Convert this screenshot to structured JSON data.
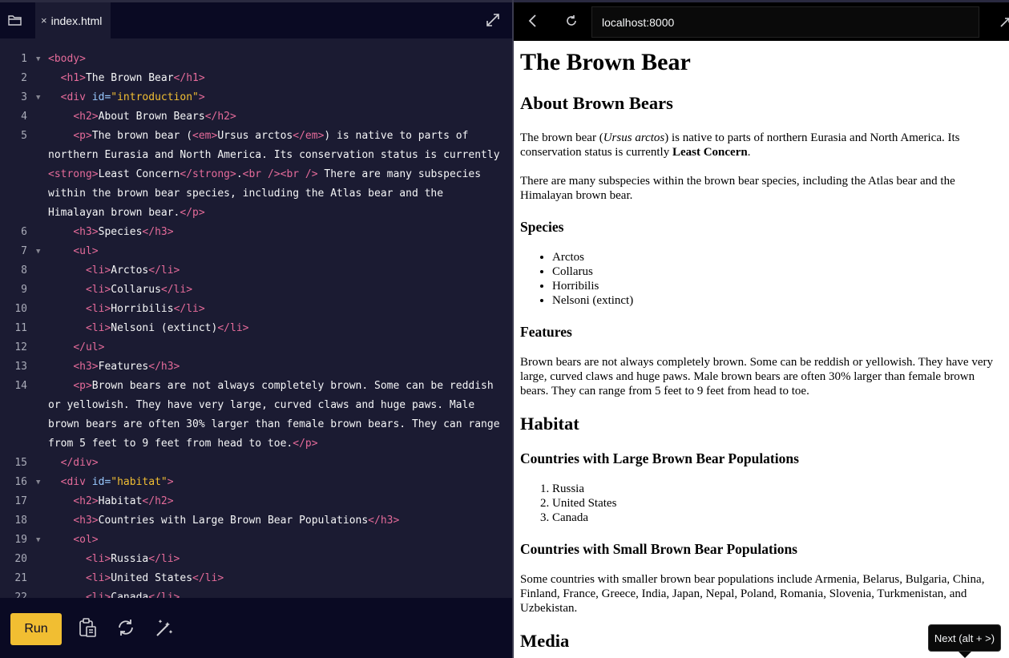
{
  "editor": {
    "file_tab": {
      "close": "×",
      "name": "index.html"
    },
    "lines": [
      {
        "n": "1",
        "fold": "▼",
        "indent": 0,
        "segs": [
          [
            "tag",
            "<body>"
          ]
        ]
      },
      {
        "n": "2",
        "fold": "",
        "indent": 2,
        "segs": [
          [
            "tag",
            "<h1>"
          ],
          [
            "text",
            "The Brown Bear"
          ],
          [
            "tag",
            "</h1>"
          ]
        ]
      },
      {
        "n": "3",
        "fold": "▼",
        "indent": 2,
        "segs": [
          [
            "tag",
            "<div "
          ],
          [
            "attr",
            "id="
          ],
          [
            "str",
            "\"introduction\""
          ],
          [
            "tag",
            ">"
          ]
        ]
      },
      {
        "n": "4",
        "fold": "",
        "indent": 4,
        "segs": [
          [
            "tag",
            "<h2>"
          ],
          [
            "text",
            "About Brown Bears"
          ],
          [
            "tag",
            "</h2>"
          ]
        ]
      },
      {
        "n": "5",
        "fold": "",
        "indent": 4,
        "segs": [
          [
            "tag",
            "<p>"
          ],
          [
            "text",
            "The brown bear ("
          ],
          [
            "tag",
            "<em>"
          ],
          [
            "text",
            "Ursus arctos"
          ],
          [
            "tag",
            "</em>"
          ],
          [
            "text",
            ") is native to parts of northern Eurasia and North America. Its conservation status is currently "
          ],
          [
            "tag",
            "<strong>"
          ],
          [
            "text",
            "Least Concern"
          ],
          [
            "tag",
            "</strong>"
          ],
          [
            "text",
            "."
          ],
          [
            "tag",
            "<br />"
          ],
          [
            "tag",
            "<br />"
          ],
          [
            "text",
            " There are many subspecies within the brown bear species, including the Atlas bear and the Himalayan brown bear."
          ],
          [
            "tag",
            "</p>"
          ]
        ]
      },
      {
        "n": "6",
        "fold": "",
        "indent": 4,
        "segs": [
          [
            "tag",
            "<h3>"
          ],
          [
            "text",
            "Species"
          ],
          [
            "tag",
            "</h3>"
          ]
        ]
      },
      {
        "n": "7",
        "fold": "▼",
        "indent": 4,
        "segs": [
          [
            "tag",
            "<ul>"
          ]
        ]
      },
      {
        "n": "8",
        "fold": "",
        "indent": 6,
        "segs": [
          [
            "tag",
            "<li>"
          ],
          [
            "text",
            "Arctos"
          ],
          [
            "tag",
            "</li>"
          ]
        ]
      },
      {
        "n": "9",
        "fold": "",
        "indent": 6,
        "segs": [
          [
            "tag",
            "<li>"
          ],
          [
            "text",
            "Collarus"
          ],
          [
            "tag",
            "</li>"
          ]
        ]
      },
      {
        "n": "10",
        "fold": "",
        "indent": 6,
        "segs": [
          [
            "tag",
            "<li>"
          ],
          [
            "text",
            "Horribilis"
          ],
          [
            "tag",
            "</li>"
          ]
        ]
      },
      {
        "n": "11",
        "fold": "",
        "indent": 6,
        "segs": [
          [
            "tag",
            "<li>"
          ],
          [
            "text",
            "Nelsoni (extinct)"
          ],
          [
            "tag",
            "</li>"
          ]
        ]
      },
      {
        "n": "12",
        "fold": "",
        "indent": 4,
        "segs": [
          [
            "tag",
            "</ul>"
          ]
        ]
      },
      {
        "n": "13",
        "fold": "",
        "indent": 4,
        "segs": [
          [
            "tag",
            "<h3>"
          ],
          [
            "text",
            "Features"
          ],
          [
            "tag",
            "</h3>"
          ]
        ]
      },
      {
        "n": "14",
        "fold": "",
        "indent": 4,
        "segs": [
          [
            "tag",
            "<p>"
          ],
          [
            "text",
            "Brown bears are not always completely brown. Some can be reddish or yellowish. They have very large, curved claws and huge paws. Male brown bears are often 30% larger than female brown bears. They can range from 5 feet to 9 feet from head to toe."
          ],
          [
            "tag",
            "</p>"
          ]
        ]
      },
      {
        "n": "15",
        "fold": "",
        "indent": 2,
        "segs": [
          [
            "tag",
            "</div>"
          ]
        ]
      },
      {
        "n": "16",
        "fold": "▼",
        "indent": 2,
        "segs": [
          [
            "tag",
            "<div "
          ],
          [
            "attr",
            "id="
          ],
          [
            "str",
            "\"habitat\""
          ],
          [
            "tag",
            ">"
          ]
        ]
      },
      {
        "n": "17",
        "fold": "",
        "indent": 4,
        "segs": [
          [
            "tag",
            "<h2>"
          ],
          [
            "text",
            "Habitat"
          ],
          [
            "tag",
            "</h2>"
          ]
        ]
      },
      {
        "n": "18",
        "fold": "",
        "indent": 4,
        "segs": [
          [
            "tag",
            "<h3>"
          ],
          [
            "text",
            "Countries with Large Brown Bear Populations"
          ],
          [
            "tag",
            "</h3>"
          ]
        ]
      },
      {
        "n": "19",
        "fold": "▼",
        "indent": 4,
        "segs": [
          [
            "tag",
            "<ol>"
          ]
        ]
      },
      {
        "n": "20",
        "fold": "",
        "indent": 6,
        "segs": [
          [
            "tag",
            "<li>"
          ],
          [
            "text",
            "Russia"
          ],
          [
            "tag",
            "</li>"
          ]
        ]
      },
      {
        "n": "21",
        "fold": "",
        "indent": 6,
        "segs": [
          [
            "tag",
            "<li>"
          ],
          [
            "text",
            "United States"
          ],
          [
            "tag",
            "</li>"
          ]
        ]
      },
      {
        "n": "22",
        "fold": "",
        "indent": 6,
        "segs": [
          [
            "tag",
            "<li>"
          ],
          [
            "text",
            "Canada"
          ],
          [
            "tag",
            "</li>"
          ]
        ]
      }
    ],
    "toolbar": {
      "run_label": "Run"
    },
    "icons": {
      "folder": "folder-icon",
      "expand": "expand-icon",
      "clipboard": "clipboard-icon",
      "reset": "reset-icon",
      "format": "magic-wand-icon"
    }
  },
  "browser": {
    "url": "localhost:8000",
    "icons": {
      "back": "back-icon",
      "reload": "reload-icon"
    }
  },
  "page": {
    "title": "The Brown Bear",
    "about_heading": "About Brown Bears",
    "intro_1": "The brown bear (",
    "intro_em": "Ursus arctos",
    "intro_2": ") is native to parts of northern Eurasia and North America. Its conservation status is currently ",
    "intro_strong": "Least Concern",
    "intro_3": ".",
    "intro_4": "There are many subspecies within the brown bear species, including the Atlas bear and the Himalayan brown bear.",
    "species_heading": "Species",
    "species": [
      "Arctos",
      "Collarus",
      "Horribilis",
      "Nelsoni (extinct)"
    ],
    "features_heading": "Features",
    "features_text": "Brown bears are not always completely brown. Some can be reddish or yellowish. They have very large, curved claws and huge paws. Male brown bears are often 30% larger than female brown bears. They can range from 5 feet to 9 feet from head to toe.",
    "habitat_heading": "Habitat",
    "large_heading": "Countries with Large Brown Bear Populations",
    "large_countries": [
      "Russia",
      "United States",
      "Canada"
    ],
    "small_heading": "Countries with Small Brown Bear Populations",
    "small_text": "Some countries with smaller brown bear populations include Armenia, Belarus, Bulgaria, China, Finland, France, Greece, India, Japan, Nepal, Poland, Romania, Slovenia, Turkmenistan, and Uzbekistan.",
    "media_heading": "Media"
  },
  "tooltip": {
    "label": "Next (alt + >)"
  }
}
